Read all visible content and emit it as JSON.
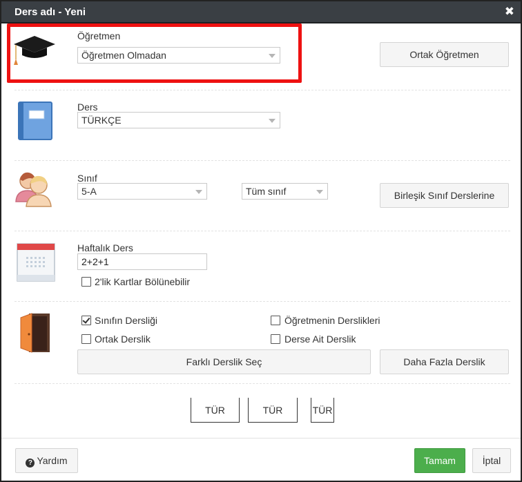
{
  "window": {
    "title": "Ders adı - Yeni",
    "close_symbol": "✖"
  },
  "teacher": {
    "label": "Öğretmen",
    "selected": "Öğretmen Olmadan",
    "shared_button": "Ortak Öğretmen"
  },
  "course": {
    "label": "Ders",
    "selected": "TÜRKÇE"
  },
  "class_section": {
    "label": "Sınıf",
    "selected": "5-A",
    "group_selected": "Tüm sınıf",
    "combined_button": "Birleşik Sınıf Derslerine"
  },
  "weekly": {
    "label": "Haftalık Ders",
    "value": "2+2+1",
    "split_checkbox_label": "2'lik Kartlar Bölünebilir",
    "split_checked": false
  },
  "rooms": {
    "class_room_label": "Sınıfın Dersliği",
    "class_room_checked": true,
    "teacher_rooms_label": "Öğretmenin Derslikleri",
    "teacher_rooms_checked": false,
    "shared_room_label": "Ortak Derslik",
    "shared_room_checked": false,
    "course_room_label": "Derse Ait Derslik",
    "course_room_checked": false,
    "select_other_button": "Farklı Derslik Seç",
    "more_rooms_button": "Daha Fazla Derslik"
  },
  "type_buttons": [
    "TÜR",
    "TÜR",
    "TÜR"
  ],
  "footer": {
    "help_label": "Yardım",
    "ok_label": "Tamam",
    "cancel_label": "İptal"
  },
  "colors": {
    "titlebar": "#3a3f44",
    "highlight": "#ee1111",
    "primary": "#4cae4c"
  }
}
